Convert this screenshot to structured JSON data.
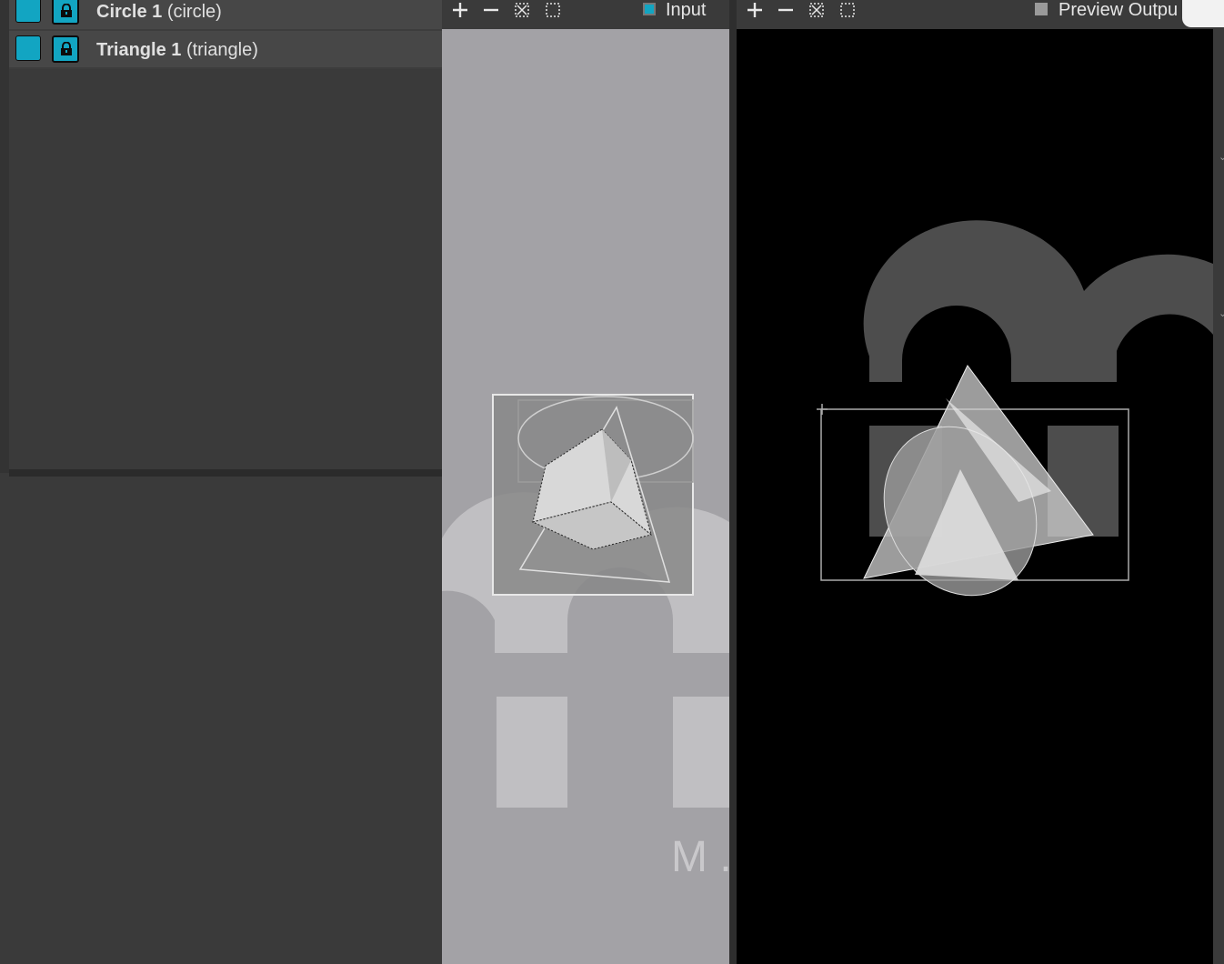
{
  "layers": [
    {
      "name": "Circle 1",
      "type": "(circle)"
    },
    {
      "name": "Triangle 1",
      "type": "(triangle)"
    }
  ],
  "input_toolbar": {
    "label": "Input",
    "checkbox_color": "#12a5c2"
  },
  "output_toolbar": {
    "label": "Preview Outpu",
    "checkbox_color": "#9a9a9a"
  },
  "input_viewer": {
    "watermark_text": "M ."
  },
  "colors": {
    "accent": "#12a5c2",
    "panel_bg": "#3a3a3a",
    "input_bg": "#a3a2a6",
    "output_bg": "#000000"
  },
  "icons": [
    "lock-icon",
    "plus-icon",
    "minus-icon",
    "zoom-fit-icon",
    "zoom-selection-icon"
  ]
}
